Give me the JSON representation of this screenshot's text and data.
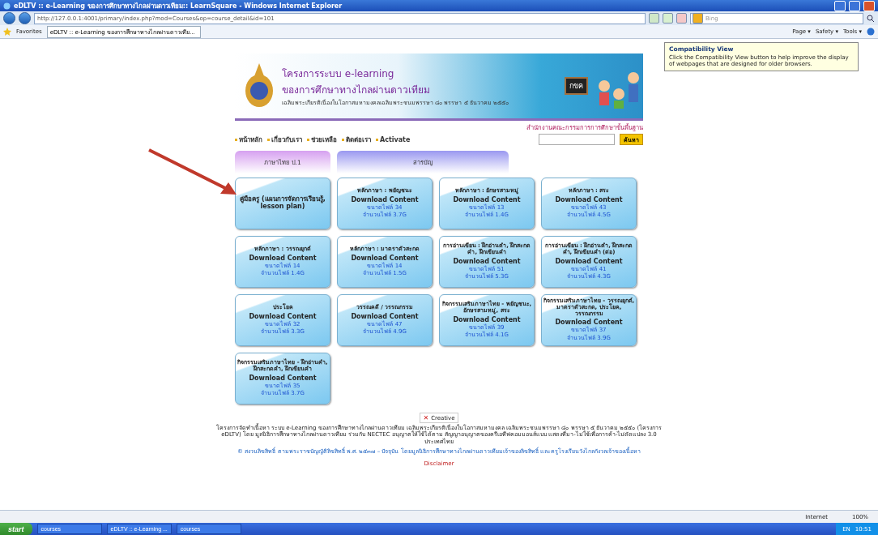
{
  "window": {
    "title": "eDLTV :: e-Learning ของการศึกษาทางไกลผ่านดาวเทียม:: LearnSquare - Windows Internet Explorer"
  },
  "address_bar": {
    "url": "http://127.0.0.1:4001/primary/index.php?mod=Courses&op=course_detail&id=101",
    "search_placeholder": "Bing"
  },
  "favorites_bar": {
    "favorites": "Favorites",
    "tab": "eDLTV :: e-Learning ของการศึกษาทางไกลผ่านดาวเทีย...",
    "menus": [
      "Page ▾",
      "Safety ▾",
      "Tools ▾"
    ]
  },
  "popup": {
    "title": "Compatibility View",
    "text": "Click the Compatibility View button to help improve the display of webpages that are designed for older browsers."
  },
  "banner": {
    "title_1": "โครงการระบบ e-learning",
    "title_2": "ของการศึกษาทางไกลผ่านดาวเทียม",
    "subtitle": "เฉลิมพระเกียรติเนื่องในโอกาสมหามงคลเฉลิมพระชนมพรรษา ๘๐ พรรษา ๕ ธันวาคม ๒๕๕๐",
    "board": "กขค",
    "agency": "สำนักงานคณะกรรมการการศึกษาขั้นพื้นฐาน"
  },
  "nav": [
    "หน้าหลัก",
    "เกี่ยวกับเรา",
    "ช่วยเหลือ",
    "ติดต่อเรา",
    "Activate"
  ],
  "search_button": "ค้นหา",
  "subject_header": "ภาษาไทย ป.1",
  "contents_header": "สารบัญ",
  "cards": [
    {
      "kind": "lesson",
      "title": "คู่มือครู (แผนการจัดการเรียนรู้, lesson plan)"
    },
    {
      "kind": "download",
      "title": "หลักภาษา : พยัญชนะ",
      "link": "Download Content",
      "size": "ขนาดไฟล์ 34",
      "count": "จำนวนไฟล์ 3.7G"
    },
    {
      "kind": "download",
      "title": "หลักภาษา : อักษรสามหมู่",
      "link": "Download Content",
      "size": "ขนาดไฟล์ 13",
      "count": "จำนวนไฟล์ 1.4G"
    },
    {
      "kind": "download",
      "title": "หลักภาษา : สระ",
      "link": "Download Content",
      "size": "ขนาดไฟล์ 43",
      "count": "จำนวนไฟล์ 4.5G"
    },
    {
      "kind": "download",
      "title": "หลักภาษา : วรรณยุกต์",
      "link": "Download Content",
      "size": "ขนาดไฟล์ 14",
      "count": "จำนวนไฟล์ 1.4G"
    },
    {
      "kind": "download",
      "title": "หลักภาษา : มาตราตัวสะกด",
      "link": "Download Content",
      "size": "ขนาดไฟล์ 14",
      "count": "จำนวนไฟล์ 1.5G"
    },
    {
      "kind": "download",
      "title": "การอ่านเขียน : ฝึกอ่านคำ, ฝึกสะกดคำ, ฝึกเขียนคำ",
      "link": "Download Content",
      "size": "ขนาดไฟล์ 51",
      "count": "จำนวนไฟล์ 5.3G"
    },
    {
      "kind": "download",
      "title": "การอ่านเขียน : ฝึกอ่านคำ, ฝึกสะกดคำ, ฝึกเขียนคำ (ต่อ)",
      "link": "Download Content",
      "size": "ขนาดไฟล์ 41",
      "count": "จำนวนไฟล์ 4.3G"
    },
    {
      "kind": "download",
      "title": "ประโยค",
      "link": "Download Content",
      "size": "ขนาดไฟล์ 32",
      "count": "จำนวนไฟล์ 3.3G"
    },
    {
      "kind": "download",
      "title": "วรรณคดี / วรรณกรรม",
      "link": "Download Content",
      "size": "ขนาดไฟล์ 47",
      "count": "จำนวนไฟล์ 4.9G"
    },
    {
      "kind": "download",
      "title": "กิจกรรมเสริมภาษาไทย - พยัญชนะ, อักษรสามหมู่, สระ",
      "link": "Download Content",
      "size": "ขนาดไฟล์ 39",
      "count": "จำนวนไฟล์ 4.1G"
    },
    {
      "kind": "download",
      "title": "กิจกรรมเสริมภาษาไทย - วรรณยุกต์, มาตราตัวสะกด, ประโยค, วรรณกรรม",
      "link": "Download Content",
      "size": "ขนาดไฟล์ 37",
      "count": "จำนวนไฟล์ 3.9G"
    },
    {
      "kind": "download",
      "title": "กิจกรรมเสริมภาษาไทย - ฝึกอ่านคำ, ฝึกสะกดคำ, ฝึกเขียนคำ",
      "link": "Download Content",
      "size": "ขนาดไฟล์ 35",
      "count": "จำนวนไฟล์ 3.7G"
    }
  ],
  "footer": {
    "broken_icon": "✕",
    "image_alt": "Creative",
    "license": "โครงการจัดทำเนื้อหา ระบบ e-Learning ของการศึกษาทางไกลผ่านดาวเทียม เฉลิมพระเกียรติเนื่องในโอกาสมหามงคล เฉลิมพระชนมพรรษา ๘๐ พรรษา ๕ ธันวาคม ๒๕๕๐ (โครงการ eDLTV) โดย มูลนิธิการศึกษาทางไกลผ่านดาวเทียม ร่วมกับ NECTEC อนุญาตให้ใช้ได้ตาม สัญญาอนุญาตของครีเอทีฟคอมมอนส์แบบ แสดงที่มา-ไม่ใช้เพื่อการค้า-ไม่ดัดแปลง 3.0 ประเทศไทย",
    "copyright": "© สงวนลิขสิทธิ์ ตามพระราชบัญญัติลิขสิทธิ์ พ.ศ. ๒๕๓๗ – ปัจจุบัน โดยมูลนิธิการศึกษาทางไกลผ่านดาวเทียมเจ้าของลิขสิทธิ์ และครูโรงเรียนวังไกลกังวลเจ้าของเนื้อหา",
    "disclaimer": "Disclaimer"
  },
  "status_bar": {
    "zone": "Internet",
    "zoom": "100%"
  },
  "taskbar": {
    "start": "start",
    "items": [
      "courses",
      "eDLTV :: e-Learning ...",
      "courses"
    ],
    "language": "EN",
    "clock": "10:51"
  }
}
